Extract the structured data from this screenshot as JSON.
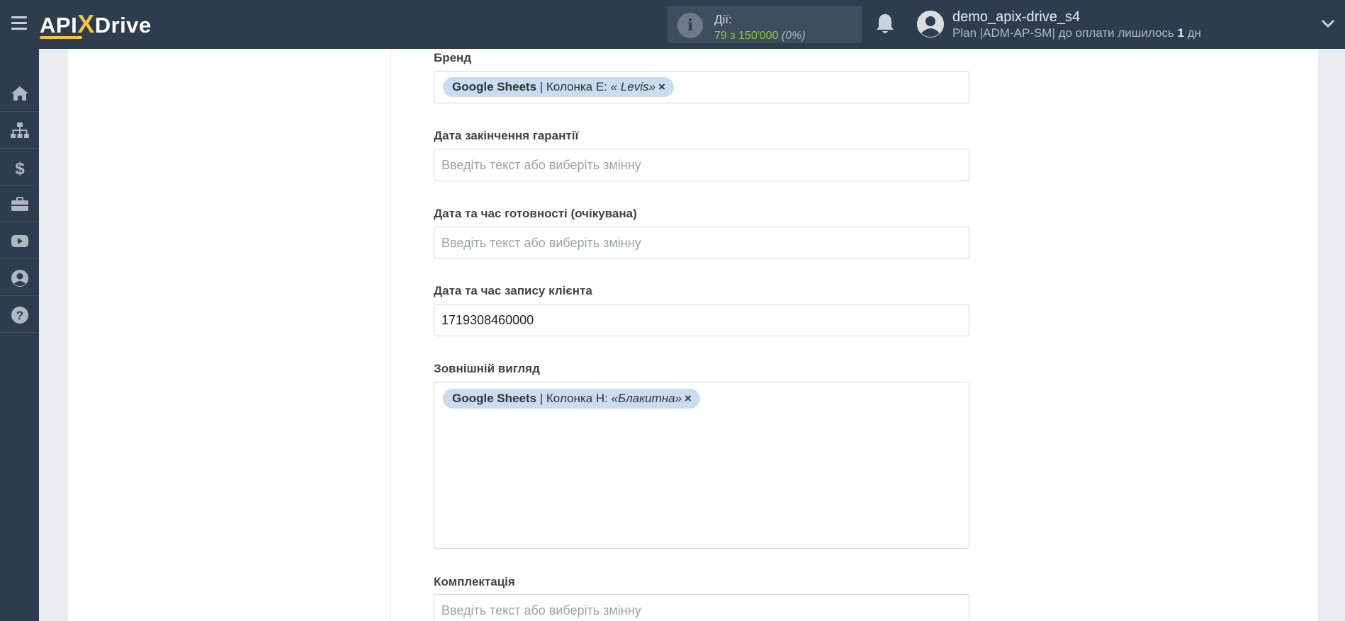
{
  "header": {
    "logo": {
      "part1": "API",
      "x": "X",
      "part2": "Drive"
    },
    "actions": {
      "title": "Дії:",
      "count": "79 з 150'000",
      "percent": "(0%)"
    },
    "user": {
      "name": "demo_apix-drive_s4",
      "plan_prefix": "Plan |ADM-AP-SM| до оплати лишилось ",
      "days": "1",
      "plan_suffix": " дн"
    }
  },
  "sidebar": {
    "items": [
      "home-icon",
      "sitemap-icon",
      "dollar-icon",
      "briefcase-icon",
      "youtube-icon",
      "user-circle-icon",
      "help-icon"
    ]
  },
  "form": {
    "fields": [
      {
        "label": "Бренд",
        "tag": {
          "source": "Google Sheets",
          "column": " | Колонка E: ",
          "value": "« Levis»",
          "remove": "×"
        }
      },
      {
        "label": "Дата закінчення гарантії",
        "placeholder": "Введіть текст або виберіть змінну"
      },
      {
        "label": "Дата та час готовності (очікувана)",
        "placeholder": "Введіть текст або виберіть змінну"
      },
      {
        "label": "Дата та час запису клієнта",
        "value": "1719308460000"
      },
      {
        "label": "Зовнішній вигляд",
        "tag": {
          "source": "Google Sheets",
          "column": " | Колонка H: ",
          "value": "«Блакитна»",
          "remove": "×"
        }
      },
      {
        "label": "Комплектація",
        "placeholder": "Введіть текст або виберіть змінну"
      }
    ]
  },
  "colors": {
    "topbar": "#2e3d4d",
    "accent": "#f5c242",
    "count": "#8cc63f",
    "tag": "#c9dcf0"
  }
}
